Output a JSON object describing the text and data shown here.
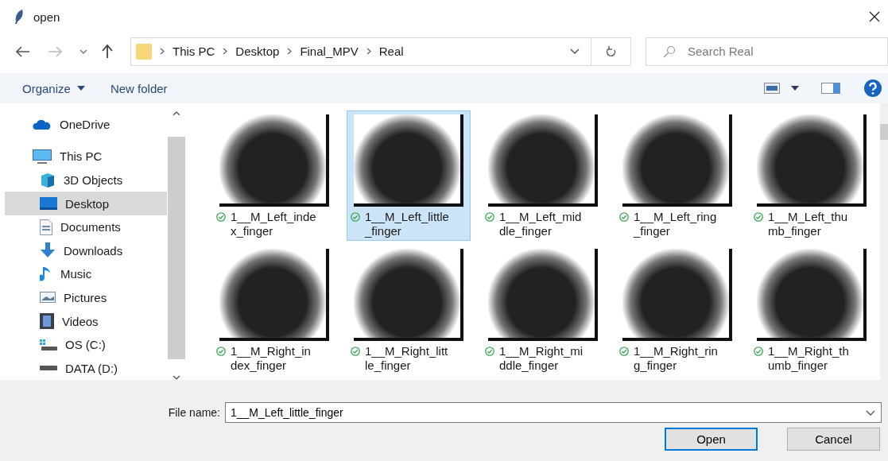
{
  "window": {
    "title": "open"
  },
  "address_bar": {
    "path": [
      "This PC",
      "Desktop",
      "Final_MPV",
      "Real"
    ]
  },
  "search": {
    "placeholder": "Search Real"
  },
  "toolbar": {
    "organize": "Organize",
    "new_folder": "New folder"
  },
  "sidebar": {
    "items": [
      {
        "label": "OneDrive",
        "selected": false
      },
      {
        "label": "This PC",
        "selected": false,
        "children": [
          {
            "label": "3D Objects",
            "selected": false
          },
          {
            "label": "Desktop",
            "selected": true
          },
          {
            "label": "Documents",
            "selected": false
          },
          {
            "label": "Downloads",
            "selected": false
          },
          {
            "label": "Music",
            "selected": false
          },
          {
            "label": "Pictures",
            "selected": false
          },
          {
            "label": "Videos",
            "selected": false
          },
          {
            "label": "OS (C:)",
            "selected": false
          },
          {
            "label": "DATA (D:)",
            "selected": false
          }
        ]
      }
    ]
  },
  "files": [
    {
      "name_lines": [
        "1__M_Left_inde",
        "x_finger"
      ],
      "selected": false
    },
    {
      "name_lines": [
        "1__M_Left_little",
        "_finger"
      ],
      "selected": true
    },
    {
      "name_lines": [
        "1__M_Left_mid",
        "dle_finger"
      ],
      "selected": false
    },
    {
      "name_lines": [
        "1__M_Left_ring",
        "_finger"
      ],
      "selected": false
    },
    {
      "name_lines": [
        "1__M_Left_thu",
        "mb_finger"
      ],
      "selected": false
    },
    {
      "name_lines": [
        "1__M_Right_in",
        "dex_finger"
      ],
      "selected": false
    },
    {
      "name_lines": [
        "1__M_Right_litt",
        "le_finger"
      ],
      "selected": false
    },
    {
      "name_lines": [
        "1__M_Right_mi",
        "ddle_finger"
      ],
      "selected": false
    },
    {
      "name_lines": [
        "1__M_Right_rin",
        "g_finger"
      ],
      "selected": false
    },
    {
      "name_lines": [
        "1__M_Right_th",
        "umb_finger"
      ],
      "selected": false
    }
  ],
  "file_name": {
    "label": "File name:",
    "value": "1__M_Left_little_finger"
  },
  "buttons": [
    {
      "label": "Open",
      "kind": "default"
    },
    {
      "label": "Cancel",
      "kind": "normal"
    }
  ]
}
